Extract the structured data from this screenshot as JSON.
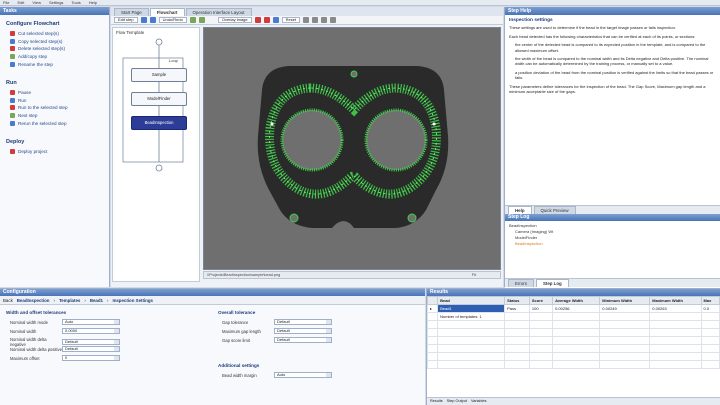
{
  "menubar": [
    "File",
    "Edit",
    "View",
    "Settings",
    "Tools",
    "Help"
  ],
  "left": {
    "header": "Tasks",
    "configure_title": "Configure Flowchart",
    "configure_items": [
      "Cut selected step(s)",
      "Copy selected step(s)",
      "Delete selected step(s)",
      "Add/copy step",
      "Rename the step"
    ],
    "run_title": "Run",
    "run_items": [
      "Pause",
      "Run",
      "Run to the selected step",
      "Next step",
      "Rerun the selected step"
    ],
    "deploy_title": "Deploy",
    "deploy_items": [
      "Deploy project"
    ]
  },
  "center": {
    "tabs": [
      "Start Page",
      "Flowchart",
      "Operation Interface Layout"
    ],
    "active_tab": "Flowchart",
    "toolbar": [
      "Edit step",
      "Undo/Redo",
      "Overlay image",
      "Reset"
    ],
    "flow_title": "Flow Template",
    "loop_label": "Loop",
    "nodes": [
      "Sample",
      "ModelFinder",
      "BeadInspection"
    ],
    "status": "\\\\Projects\\BeadInspection\\sample\\bead.png",
    "zoom": "Fit"
  },
  "help": {
    "title": "Step Help",
    "heading": "Inspection settings",
    "paragraphs": [
      "These settings are used to determine if the bead in the target image passes or fails inspection.",
      "Each bead detected has the following characteristics that can be verified at each of its points, or sections:",
      "the center of the detected bead is compared to its expected position in the template, and is compared to the allowed maximum offset.",
      "the width of the bead is compared to the nominal width and its Delta negative and Delta positive. The nominal width can be automatically determined by the training process, or manually set to a value.",
      "a position deviation of the bead from the nominal position is verified against the limits so that the bead passes or fails.",
      "These parameters define tolerances for the inspection of the bead. The Gap Score, Maximum gap length and a minimum acceptable size of the gaps."
    ],
    "tabs": [
      "Help",
      "Quick Preview"
    ],
    "steplog_title": "Step Log",
    "steplog_items": [
      "BeadInspection",
      "Camera (Imaging) Wt",
      "ModelFinder",
      "BeadInspection"
    ],
    "bottom_tabs": [
      "Errors",
      "Step Log"
    ]
  },
  "config": {
    "header": "Configuration",
    "crumbs": [
      "Back",
      "BeadInspection",
      "Templates",
      "Bead1",
      "Inspection Settings"
    ],
    "group1": "Width and offset tolerances",
    "rows1": [
      {
        "label": "Nominal width mode",
        "value": "Auto"
      },
      {
        "label": "Nominal width",
        "value": "0.0000"
      },
      {
        "label": "Nominal width delta negative",
        "value": "Default"
      },
      {
        "label": "Nominal width delta positive",
        "value": "Default"
      },
      {
        "label": "Maximum offset",
        "value": "0"
      }
    ],
    "group2": "Overall tolerance",
    "rows2": [
      {
        "label": "Gap tolerance",
        "value": "Default"
      },
      {
        "label": "Maximum gap length",
        "value": "Default"
      },
      {
        "label": "Gap score limit",
        "value": "Default"
      }
    ],
    "group3": "Additional settings",
    "rows3": [
      {
        "label": "Bead width margin",
        "value": "Auto"
      }
    ]
  },
  "results": {
    "header": "Results",
    "columns": [
      "",
      "Bead",
      "Status",
      "Score",
      "Average Width",
      "Minimum Width",
      "Maximum Width",
      "Max"
    ],
    "rows": [
      [
        "▸",
        "Bead1",
        "Pass",
        "100",
        "0.00256",
        "0.00249",
        "0.00263",
        "0.0"
      ],
      [
        "",
        "Number of templates: 1",
        "",
        "",
        "",
        "",
        "",
        ""
      ]
    ],
    "tabs": [
      "Results",
      "Step Output",
      "Variables"
    ]
  },
  "colors": {
    "accent": "#2d3c96",
    "bead": "#3fd14a",
    "part": "#2a2a2a",
    "background_img": "#6f6f6f"
  }
}
